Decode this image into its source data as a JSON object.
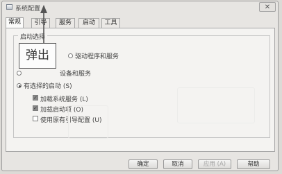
{
  "window": {
    "title": "系统配置",
    "close_glyph": "✕"
  },
  "tabs": [
    {
      "label": "常规",
      "active": true
    },
    {
      "label": "引导",
      "active": false
    },
    {
      "label": "服务",
      "active": false
    },
    {
      "label": "启动",
      "active": false
    },
    {
      "label": "工具",
      "active": false
    }
  ],
  "startup_group": {
    "title": "启动选择",
    "option_normal_tail": "驱动程序和服务",
    "option_diagnostic_tail": "设备和服务",
    "option_selective": "有选择的启动 (S)",
    "checkboxes": [
      {
        "label": "加载系统服务 (L)",
        "checked": true
      },
      {
        "label": "加载启动项 (O)",
        "checked": true
      },
      {
        "label": "使用原有引导配置 (U)",
        "checked": false
      }
    ]
  },
  "callout": {
    "text": "弹出"
  },
  "buttons": {
    "ok": "确定",
    "cancel": "取消",
    "apply": "应用 (A)",
    "help": "帮助"
  }
}
